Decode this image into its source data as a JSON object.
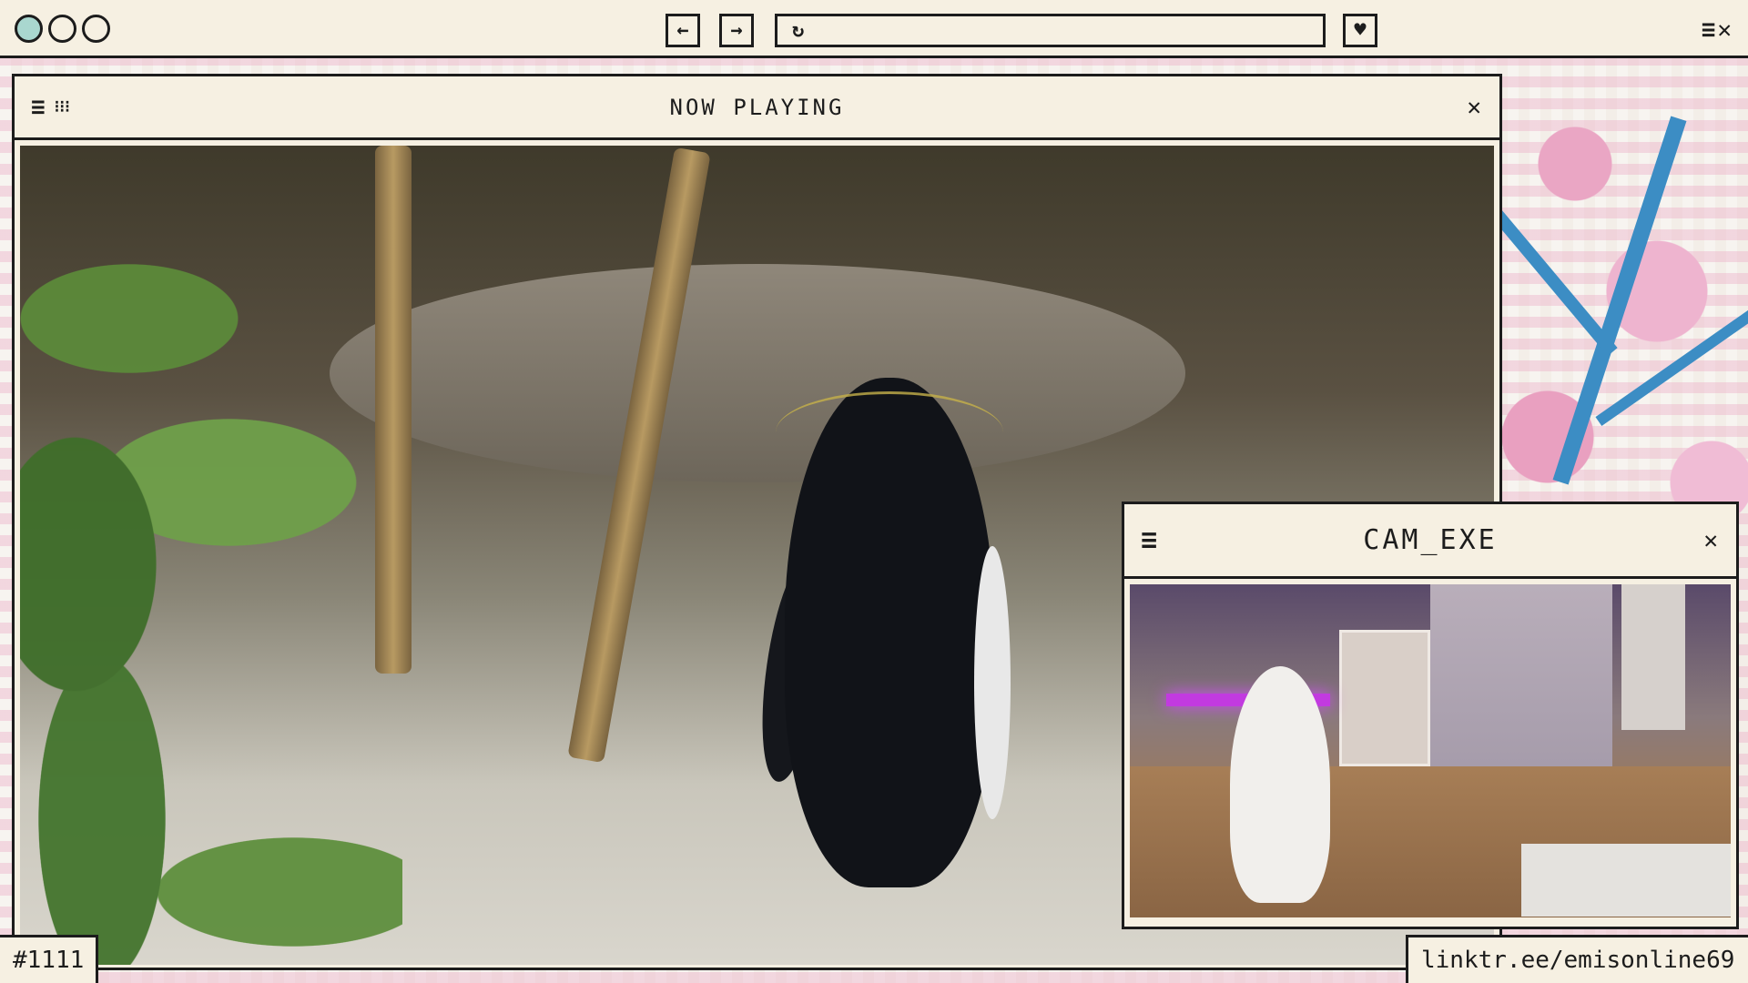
{
  "chrome": {
    "window_controls": [
      "circle-teal",
      "circle",
      "circle"
    ],
    "back_icon": "←",
    "forward_icon": "→",
    "reload_icon": "↻",
    "url": "",
    "heart_icon": "♥",
    "menu_icon": "≡",
    "close_icon": "✕"
  },
  "now_playing": {
    "title": "NOW PLAYING",
    "menu_icon": "≡",
    "grid_icon": "⁝⁝⁝",
    "close_icon": "✕"
  },
  "cam": {
    "title": "CAM_EXE",
    "menu_icon": "≡",
    "close_icon": "✕"
  },
  "tags": {
    "left": "#1111",
    "right": "linktr.ee/emisonline69"
  },
  "colors": {
    "frame": "#1c1c1c",
    "panel": "#f6f0e2",
    "accent_teal": "#a9d7cf",
    "blossom_pink": "#eaa6c4",
    "branch_blue": "#3c8dc4"
  }
}
